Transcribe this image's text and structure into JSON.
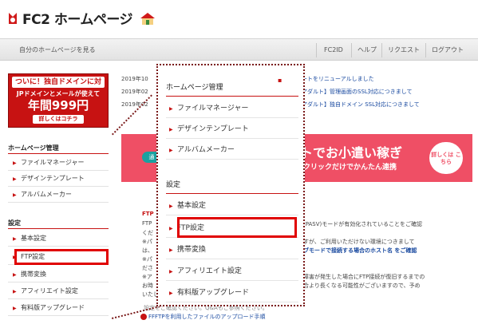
{
  "header": {
    "logo_text": "FC2 ホームページ"
  },
  "nav": {
    "my_page": "自分のホームページを見る",
    "fc2id": "FC2ID",
    "help": "ヘルプ",
    "request": "リクエスト",
    "logout": "ログアウト"
  },
  "banner": {
    "line1": "ついに！独自ドメインに対応",
    "line2": "JPドメインとメールが使えて",
    "line3": "年間999円",
    "line4": "詳しくはコチラ"
  },
  "sidebar": {
    "section1": "ホームページ管理",
    "items1": [
      "ファイルマネージャー",
      "デザインテンプレート",
      "アルバムメーカー"
    ],
    "section2": "設定",
    "items2": [
      "基本設定",
      "FTP設定",
      "携帯変換",
      "アフィリエイト設定",
      "有料版アップグレード"
    ]
  },
  "news": {
    "dates": [
      "2019年10",
      "2019年02",
      "2019年02"
    ],
    "right": [
      "ートをリニューアルしました",
      "アダルト】管理画面のSSL対応につきまして",
      "アダルト】独自ドメイン SSL対応につきまして"
    ]
  },
  "promo": {
    "badge": "通",
    "title": "トでお小遣い稼ぎ",
    "subtitle": "クリックだけでかんたん連携",
    "button": "詳しくは こちら"
  },
  "content": {
    "ftp_title": "FTP",
    "left_lines": [
      "FTP",
      "くだ",
      "※パ",
      "は、",
      "※パ",
      "ださ",
      "※ア",
      "お時",
      "いたし"
    ],
    "right_lines": [
      "(PASV)モードが有効化されていることをご確認",
      "すが、ご利用いただけない環境につきまして",
      "ブモードで接続する場合のホスト名 をご確認",
      "障害が発生した場合にFTP接続が復旧するまでの",
      "合より長くなる可能性がございますので、予め"
    ],
    "faded": "設定をご確認ください。Q&Aもご参照ください。",
    "bottom_link": "FFFTPを利用したファイルのアップロード手順"
  },
  "popup": {
    "section1": "ホームページ管理",
    "mark": "▪",
    "items1": [
      "ファイルマネージャー",
      "デザインテンプレート",
      "アルバムメーカー"
    ],
    "section2": "設定",
    "items2": [
      "基本設定",
      "FTP設定",
      "携帯変換",
      "アフィリエイト設定",
      "有料版アップグレード"
    ]
  },
  "colors": {
    "accent": "#c71212",
    "promo": "#ef4f65",
    "highlight": "#e00000"
  }
}
